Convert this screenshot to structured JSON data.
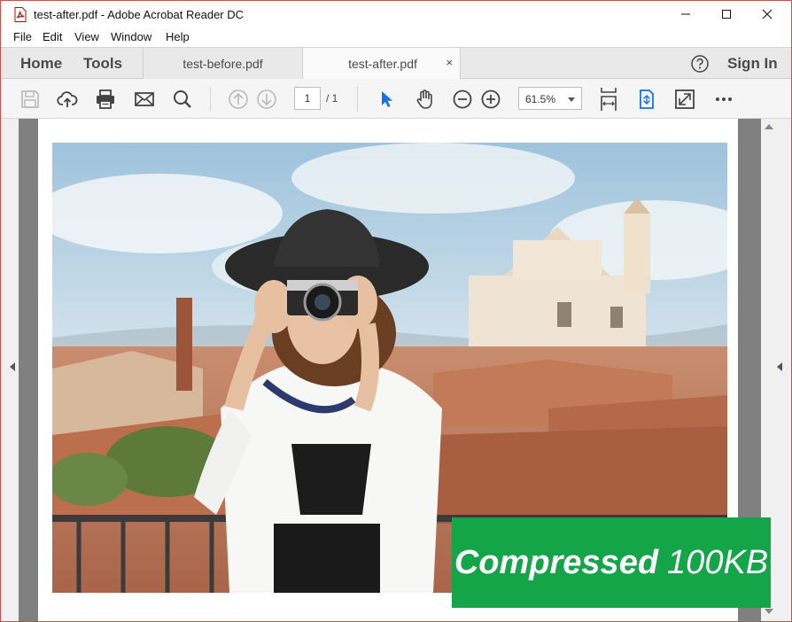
{
  "window": {
    "title": "test-after.pdf - Adobe Acrobat Reader DC",
    "app_icon": "pdf-file-icon",
    "controls": [
      "minimize-icon",
      "maximize-icon",
      "close-icon"
    ]
  },
  "menu": {
    "items": [
      {
        "label": "File"
      },
      {
        "label": "Edit"
      },
      {
        "label": "View"
      },
      {
        "label": "Window"
      },
      {
        "label": "Help"
      }
    ]
  },
  "tabs": {
    "home": "Home",
    "tools": "Tools",
    "documents": [
      {
        "label": "test-before.pdf",
        "active": false
      },
      {
        "label": "test-after.pdf",
        "active": true,
        "close": "×"
      }
    ],
    "sign_in": "Sign In",
    "help_icon": "help-circle-icon"
  },
  "toolbar": {
    "icons": [
      "save-icon",
      "upload-cloud-icon",
      "print-icon",
      "email-icon",
      "search-icon",
      "previous-page-icon",
      "next-page-icon",
      "select-arrow-icon",
      "hand-pan-icon",
      "zoom-out-icon",
      "zoom-in-icon",
      "fit-page-icon",
      "rotate-scroll-icon",
      "full-screen-icon",
      "more-options-icon"
    ],
    "page_current": "1",
    "page_total": "/ 1",
    "zoom": "61.5%"
  },
  "document": {
    "photo": "woman in black hat taking photo with vintage camera on rooftop terrace with church in background",
    "badge": {
      "strong": "Compressed",
      "light": "100KB",
      "color": "#13a548"
    }
  },
  "colors": {
    "window_border": "#c8504a",
    "accent_blue": "#1473e6",
    "tab_bg": "#e9e9e9",
    "doc_gray": "#808080"
  }
}
